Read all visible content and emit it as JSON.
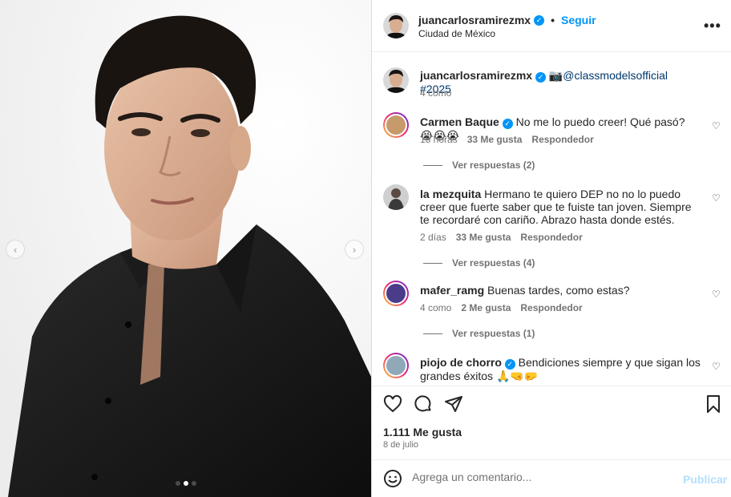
{
  "post": {
    "author": "juancarlosramirezmx",
    "verified_mark": "✓",
    "separator": "•",
    "follow_label": "Seguir",
    "location": "Ciudad de México",
    "more_icon": "more-horizontal-icon"
  },
  "caption": {
    "username": "juancarlosramirezmx",
    "camera_emoji": "📷",
    "mention": "@classmodelsofficial",
    "hashtag": "#2025",
    "time": "4 como"
  },
  "comments": [
    {
      "username": "Carmen Baque",
      "verified": true,
      "text": "No me lo puedo creer! Qué pasó? 😭😭😭",
      "time": "15 horas",
      "likes": "33 Me gusta",
      "reply": "Respondedor",
      "replies": "Ver respuestas (2)",
      "has_story_ring": true,
      "avatar_color": "#c79a6b"
    },
    {
      "username": "la mezquita",
      "verified": false,
      "text": "Hermano te quiero DEP no no lo puedo creer que fuerte saber que te fuiste tan joven. Siempre te recordaré con cariño. Abrazo hasta donde estés.",
      "time": "2 días",
      "likes": "33 Me gusta",
      "reply": "Respondedor",
      "replies": "Ver respuestas (4)",
      "has_story_ring": false,
      "avatar_color": "#6f6f6f"
    },
    {
      "username": "mafer_ramg",
      "verified": false,
      "text": "Buenas tardes, como estas?",
      "time": "4 como",
      "likes": "2 Me gusta",
      "reply": "Respondedor",
      "replies": "Ver respuestas (1)",
      "has_story_ring": true,
      "avatar_color": "#4b3c8a"
    },
    {
      "username": "piojo de chorro",
      "verified": true,
      "text": "Bendiciones siempre y que sigan los grandes éxitos 🙏🤜🤛",
      "has_story_ring": true,
      "avatar_color": "#8fa9b8"
    }
  ],
  "actions": {
    "like_icon": "heart-icon",
    "comment_icon": "comment-icon",
    "share_icon": "send-icon",
    "save_icon": "bookmark-icon",
    "likes_count": "1.111 Me gusta",
    "date": "8 de julio"
  },
  "composer": {
    "placeholder": "Agrega un comentario...",
    "publish_label": "Publicar"
  },
  "carousel": {
    "prev_icon": "chevron-left-icon",
    "next_icon": "chevron-right-icon",
    "slide_count": 3,
    "active_index": 1
  },
  "colors": {
    "accent": "#0095f6",
    "text": "#262626",
    "muted": "#737373",
    "publish_disabled": "#b2dffc"
  }
}
